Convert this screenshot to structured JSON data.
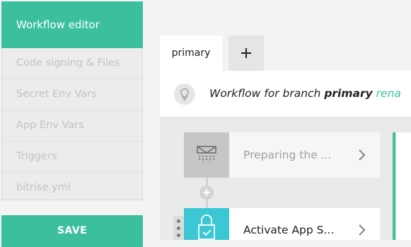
{
  "sidebar": {
    "active_item": "Workflow editor",
    "items": [
      {
        "label": "Code signing & Files"
      },
      {
        "label": "Secret Env Vars"
      },
      {
        "label": "App Env Vars"
      },
      {
        "label": "Triggers"
      },
      {
        "label": "bitrise.yml"
      }
    ],
    "save_label": "SAVE"
  },
  "tabs": {
    "active_tab": "primary",
    "add_tab": "+"
  },
  "info_bar": {
    "icon": "lightbulb-icon",
    "prefix": "Workflow for branch ",
    "branch": "primary",
    "rename": "rena"
  },
  "steps": [
    {
      "label": "Preparing the ...",
      "icon": "shower-icon"
    },
    {
      "label": "Activate App S...",
      "icon": "lock-check-icon"
    }
  ],
  "colors": {
    "accent": "#3bbf9c",
    "step_icon_teal": "#3bc7d4"
  }
}
